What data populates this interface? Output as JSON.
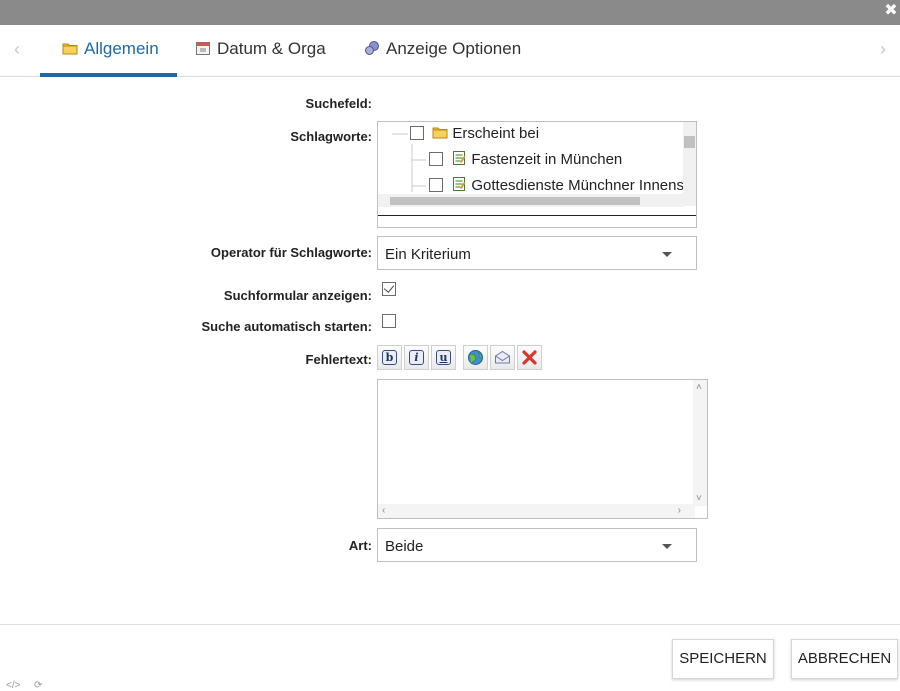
{
  "window": {
    "close_glyph": "✖"
  },
  "tabs": {
    "prev_glyph": "‹",
    "next_glyph": "›",
    "items": [
      {
        "label": "Allgemein",
        "icon": "folder-icon",
        "active": true
      },
      {
        "label": "Datum & Orga",
        "icon": "calendar-icon",
        "active": false
      },
      {
        "label": "Anzeige Optionen",
        "icon": "display-options-icon",
        "active": false
      }
    ]
  },
  "form": {
    "suchefeld_label": "Suchefeld:",
    "schlagworte_label": "Schlagworte:",
    "tree": {
      "items": [
        {
          "label": "Erscheint bei",
          "icon": "folder-icon",
          "checked": false
        },
        {
          "label": "Fastenzeit in München",
          "icon": "document-icon",
          "checked": false
        },
        {
          "label": "Gottesdienste Münchner Innens",
          "icon": "document-icon",
          "checked": false
        }
      ]
    },
    "operator_label": "Operator für Schlagworte:",
    "operator_value": "Ein Kriterium",
    "suchformular_label": "Suchformular anzeigen:",
    "suchformular_checked": true,
    "auto_start_label": "Suche automatisch starten:",
    "auto_start_checked": false,
    "fehlertext_label": "Fehlertext:",
    "editor_buttons": [
      {
        "name": "bold-button",
        "glyph": "b"
      },
      {
        "name": "italic-button",
        "glyph": "i"
      },
      {
        "name": "underline-button",
        "glyph": "u"
      },
      {
        "name": "link-button",
        "glyph": "globe-icon"
      },
      {
        "name": "email-button",
        "glyph": "mail-icon"
      },
      {
        "name": "clear-button",
        "glyph": "x-icon"
      }
    ],
    "fehlertext_value": "",
    "art_label": "Art:",
    "art_value": "Beide"
  },
  "footer": {
    "save_label": "SPEICHERN",
    "cancel_label": "ABBRECHEN",
    "source_glyph": "</>",
    "refresh_glyph": "⟳"
  },
  "colors": {
    "accent": "#1e6aa8",
    "titlebar": "#8a8a8a"
  }
}
